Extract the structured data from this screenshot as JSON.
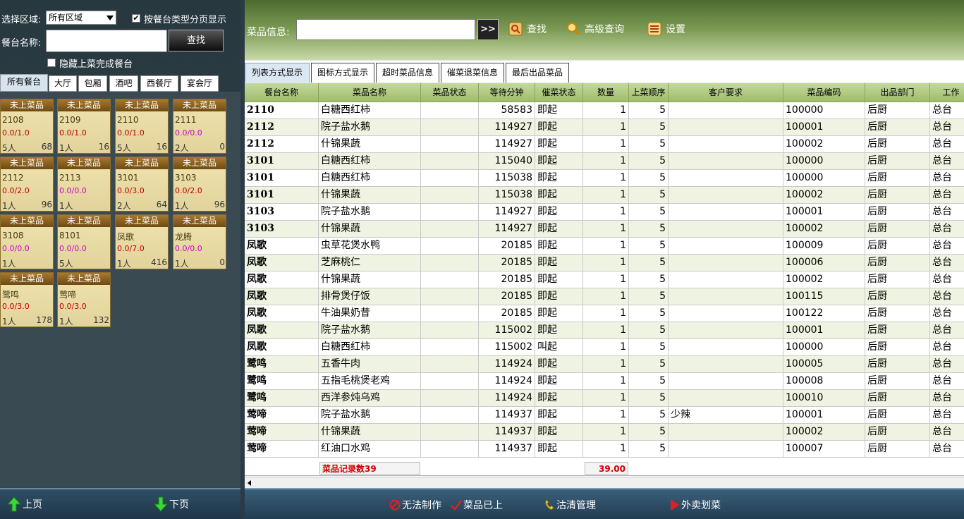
{
  "left": {
    "area_label": "选择区域:",
    "area_value": "所有区域",
    "paging_checkbox_label": "按餐台类型分页显示",
    "paging_checked": true,
    "table_name_label": "餐台名称:",
    "table_name_value": "",
    "search_button": "查找",
    "hide_done_label": "隐藏上菜完成餐台",
    "hide_done_checked": false,
    "tabs": [
      "所有餐台",
      "大厅",
      "包厢",
      "酒吧",
      "西餐厅",
      "宴会厅"
    ],
    "tiles": [
      {
        "status": "未上菜品",
        "name": "2108",
        "ratio": "0.0/1.0",
        "ratio_color": "red",
        "people": "5人",
        "minutes": "68"
      },
      {
        "status": "未上菜品",
        "name": "2109",
        "ratio": "0.0/1.0",
        "ratio_color": "red",
        "people": "1人",
        "minutes": "16"
      },
      {
        "status": "未上菜品",
        "name": "2110",
        "ratio": "0.0/1.0",
        "ratio_color": "red",
        "people": "5人",
        "minutes": "16"
      },
      {
        "status": "未上菜品",
        "name": "2111",
        "ratio": "0.0/0.0",
        "ratio_color": "pink",
        "people": "2人",
        "minutes": "0"
      },
      {
        "status": "未上菜品",
        "name": "2112",
        "ratio": "0.0/2.0",
        "ratio_color": "red",
        "people": "1人",
        "minutes": "96"
      },
      {
        "status": "未上菜品",
        "name": "2113",
        "ratio": "0.0/0.0",
        "ratio_color": "pink",
        "people": "1人",
        "minutes": ""
      },
      {
        "status": "未上菜品",
        "name": "3101",
        "ratio": "0.0/3.0",
        "ratio_color": "red",
        "people": "2人",
        "minutes": "64"
      },
      {
        "status": "未上菜品",
        "name": "3103",
        "ratio": "0.0/2.0",
        "ratio_color": "red",
        "people": "1人",
        "minutes": "96"
      },
      {
        "status": "未上菜品",
        "name": "3108",
        "ratio": "0.0/0.0",
        "ratio_color": "pink",
        "people": "1人",
        "minutes": ""
      },
      {
        "status": "未上菜品",
        "name": "8101",
        "ratio": "0.0/0.0",
        "ratio_color": "pink",
        "people": "5人",
        "minutes": ""
      },
      {
        "status": "未上菜品",
        "name": "凤歌",
        "ratio": "0.0/7.0",
        "ratio_color": "red",
        "people": "1人",
        "minutes": "416"
      },
      {
        "status": "未上菜品",
        "name": "龙腾",
        "ratio": "0.0/0.0",
        "ratio_color": "pink",
        "people": "1人",
        "minutes": "0"
      },
      {
        "status": "未上菜品",
        "name": "鹭鸣",
        "ratio": "0.0/3.0",
        "ratio_color": "red",
        "people": "1人",
        "minutes": "178"
      },
      {
        "status": "未上菜品",
        "name": "莺啼",
        "ratio": "0.0/3.0",
        "ratio_color": "red",
        "people": "1人",
        "minutes": "132"
      }
    ],
    "prev_page": "上页",
    "next_page": "下页"
  },
  "header": {
    "dish_info_label": "菜品信息:",
    "dish_info_value": "",
    "go_button": ">>",
    "search": "查找",
    "advanced_search": "高级查询",
    "settings": "设置"
  },
  "tabs": [
    "列表方式显示",
    "图标方式显示",
    "超时菜品信息",
    "催菜退菜信息",
    "最后出品菜品"
  ],
  "grid": {
    "columns": [
      "餐台名称",
      "菜品名称",
      "菜品状态",
      "等待分钟",
      "催菜状态",
      "数量",
      "上菜顺序",
      "客户要求",
      "菜品编码",
      "出品部门",
      "工作"
    ],
    "rows": [
      [
        "2110",
        "白糖西红柿",
        "",
        "58583",
        "即起",
        "1",
        "5",
        "",
        "100000",
        "后厨",
        "总台"
      ],
      [
        "2112",
        "院子盐水鹅",
        "",
        "114927",
        "即起",
        "1",
        "5",
        "",
        "100001",
        "后厨",
        "总台"
      ],
      [
        "2112",
        "什锦果蔬",
        "",
        "114927",
        "即起",
        "1",
        "5",
        "",
        "100002",
        "后厨",
        "总台"
      ],
      [
        "3101",
        "白糖西红柿",
        "",
        "115040",
        "即起",
        "1",
        "5",
        "",
        "100000",
        "后厨",
        "总台"
      ],
      [
        "3101",
        "白糖西红柿",
        "",
        "115038",
        "即起",
        "1",
        "5",
        "",
        "100000",
        "后厨",
        "总台"
      ],
      [
        "3101",
        "什锦果蔬",
        "",
        "115038",
        "即起",
        "1",
        "5",
        "",
        "100002",
        "后厨",
        "总台"
      ],
      [
        "3103",
        "院子盐水鹅",
        "",
        "114927",
        "即起",
        "1",
        "5",
        "",
        "100001",
        "后厨",
        "总台"
      ],
      [
        "3103",
        "什锦果蔬",
        "",
        "114927",
        "即起",
        "1",
        "5",
        "",
        "100002",
        "后厨",
        "总台"
      ],
      [
        "凤歌",
        "虫草花煲水鸭",
        "",
        "20185",
        "即起",
        "1",
        "5",
        "",
        "100009",
        "后厨",
        "总台"
      ],
      [
        "凤歌",
        "芝麻桃仁",
        "",
        "20185",
        "即起",
        "1",
        "5",
        "",
        "100006",
        "后厨",
        "总台"
      ],
      [
        "凤歌",
        "什锦果蔬",
        "",
        "20185",
        "即起",
        "1",
        "5",
        "",
        "100002",
        "后厨",
        "总台"
      ],
      [
        "凤歌",
        "排骨煲仔饭",
        "",
        "20185",
        "即起",
        "1",
        "5",
        "",
        "100115",
        "后厨",
        "总台"
      ],
      [
        "凤歌",
        "牛油果奶昔",
        "",
        "20185",
        "即起",
        "1",
        "5",
        "",
        "100122",
        "后厨",
        "总台"
      ],
      [
        "凤歌",
        "院子盐水鹅",
        "",
        "115002",
        "即起",
        "1",
        "5",
        "",
        "100001",
        "后厨",
        "总台"
      ],
      [
        "凤歌",
        "白糖西红柿",
        "",
        "115002",
        "叫起",
        "1",
        "5",
        "",
        "100000",
        "后厨",
        "总台"
      ],
      [
        "鹭鸣",
        "五香牛肉",
        "",
        "114924",
        "即起",
        "1",
        "5",
        "",
        "100005",
        "后厨",
        "总台"
      ],
      [
        "鹭鸣",
        "五指毛桃煲老鸡",
        "",
        "114924",
        "即起",
        "1",
        "5",
        "",
        "100008",
        "后厨",
        "总台"
      ],
      [
        "鹭鸣",
        "西洋参炖乌鸡",
        "",
        "114924",
        "即起",
        "1",
        "5",
        "",
        "100010",
        "后厨",
        "总台"
      ],
      [
        "莺啼",
        "院子盐水鹅",
        "",
        "114937",
        "即起",
        "1",
        "5",
        "少辣",
        "100001",
        "后厨",
        "总台"
      ],
      [
        "莺啼",
        "什锦果蔬",
        "",
        "114937",
        "即起",
        "1",
        "5",
        "",
        "100002",
        "后厨",
        "总台"
      ],
      [
        "莺啼",
        "红油口水鸡",
        "",
        "114937",
        "即起",
        "1",
        "5",
        "",
        "100007",
        "后厨",
        "总台"
      ]
    ],
    "record_count": "菜品记录数39",
    "qty_total": "39.00"
  },
  "footer": {
    "cannot_make": "无法制作",
    "served": "菜品已上",
    "sold_out": "沽清管理",
    "takeout": "外卖划菜"
  }
}
